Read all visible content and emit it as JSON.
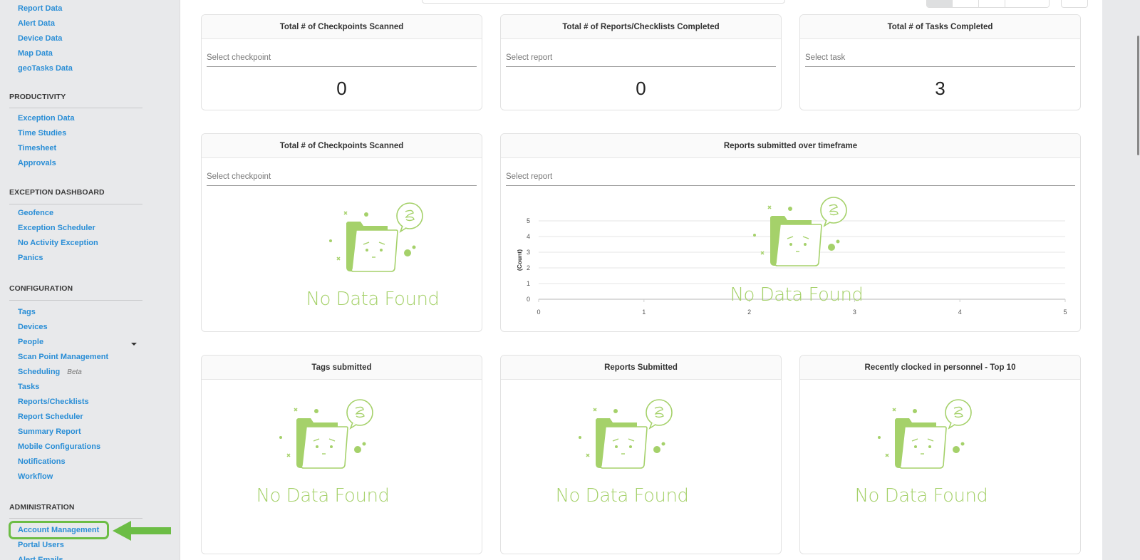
{
  "sidebar": {
    "top_items": [
      "Report Data",
      "Alert Data",
      "Device Data",
      "Map Data",
      "geoTasks Data"
    ],
    "sections": [
      {
        "heading": "PRODUCTIVITY",
        "items": [
          "Exception Data",
          "Time Studies",
          "Timesheet",
          "Approvals"
        ]
      },
      {
        "heading": "EXCEPTION DASHBOARD",
        "items": [
          "Geofence",
          "Exception Scheduler",
          "No Activity Exception",
          "Panics"
        ]
      },
      {
        "heading": "CONFIGURATION",
        "items": [
          "Tags",
          "Devices",
          "People",
          "Scan Point Management",
          "Scheduling",
          "Tasks",
          "Reports/Checklists",
          "Report Scheduler",
          "Summary Report",
          "Mobile Configurations",
          "Notifications",
          "Workflow"
        ],
        "scheduling_badge": "Beta"
      },
      {
        "heading": "ADMINISTRATION",
        "items": [
          "Account Management",
          "Portal Users",
          "Alert Emails"
        ]
      }
    ],
    "highlighted_item": "Account Management",
    "highlight_color": "#6cbd45"
  },
  "cards": {
    "checkpoints_count": {
      "title": "Total # of Checkpoints Scanned",
      "placeholder": "Select checkpoint",
      "value": "0"
    },
    "reports_count": {
      "title": "Total # of Reports/Checklists Completed",
      "placeholder": "Select report",
      "value": "0"
    },
    "tasks_count": {
      "title": "Total # of Tasks Completed",
      "placeholder": "Select task",
      "value": "3"
    },
    "checkpoints_chart": {
      "title": "Total # of Checkpoints Scanned",
      "placeholder": "Select checkpoint",
      "empty_text": "No Data Found"
    },
    "reports_timeframe": {
      "title": "Reports submitted over timeframe",
      "placeholder": "Select report",
      "empty_text": "No Data Found"
    },
    "tags_submitted": {
      "title": "Tags submitted",
      "empty_text": "No Data Found"
    },
    "reports_submitted": {
      "title": "Reports Submitted",
      "empty_text": "No Data Found"
    },
    "recent_personnel": {
      "title": "Recently clocked in personnel - Top 10",
      "empty_text": "No Data Found"
    }
  },
  "chart_data": {
    "type": "line",
    "title": "Reports submitted over timeframe",
    "xlabel": "",
    "ylabel": "(Count)",
    "x_ticks": [
      "0",
      "1",
      "2",
      "3",
      "4",
      "5"
    ],
    "y_ticks": [
      "0",
      "1",
      "2",
      "3",
      "4",
      "5"
    ],
    "xlim": [
      0,
      5
    ],
    "ylim": [
      0,
      5
    ],
    "grid": true,
    "series": []
  },
  "colors": {
    "link": "#2a8ed6",
    "empty_state_green": "#a5d16a",
    "sidebar_bg": "#e8e9eb"
  }
}
